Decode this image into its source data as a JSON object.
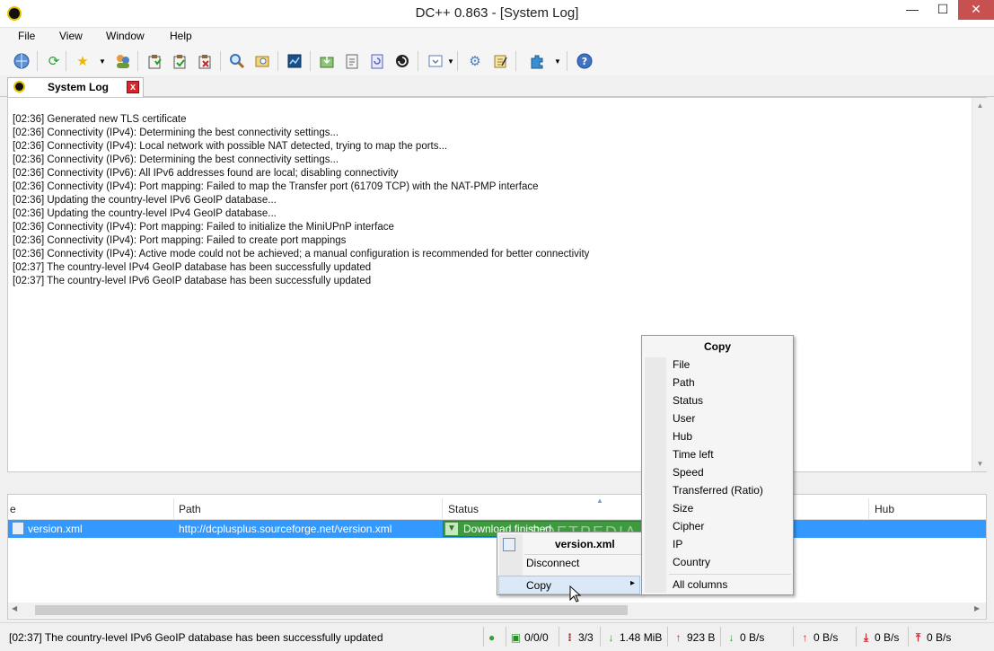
{
  "window": {
    "title": "DC++ 0.863 - [System Log]",
    "minimize": "—",
    "maximize": "☐",
    "close": "✕"
  },
  "menu": [
    "File",
    "View",
    "Window",
    "Help"
  ],
  "tab": {
    "label": "System Log",
    "close": "x"
  },
  "log": [
    "[02:36] Generated new TLS certificate",
    "[02:36] Connectivity (IPv4): Determining the best connectivity settings...",
    "[02:36] Connectivity (IPv4): Local network with possible NAT detected, trying to map the ports...",
    "[02:36] Connectivity (IPv6): Determining the best connectivity settings...",
    "[02:36] Connectivity (IPv6): All IPv6 addresses found are local; disabling connectivity",
    "[02:36] Connectivity (IPv4): Port mapping: Failed to map the Transfer port (61709 TCP) with the NAT-PMP interface",
    "[02:36] Updating the country-level IPv6 GeoIP database...",
    "[02:36] Updating the country-level IPv4 GeoIP database...",
    "[02:36] Connectivity (IPv4): Port mapping: Failed to initialize the MiniUPnP interface",
    "[02:36] Connectivity (IPv4): Port mapping: Failed to create port mappings",
    "[02:36] Connectivity (IPv4): Active mode could not be achieved; a manual configuration is recommended for better connectivity",
    "[02:37] The country-level IPv4 GeoIP database has been successfully updated",
    "[02:37] The country-level IPv6 GeoIP database has been successfully updated"
  ],
  "transfers": {
    "columns": {
      "file": "e",
      "path": "Path",
      "status": "Status",
      "hub": "Hub"
    },
    "row": {
      "file": "version.xml",
      "path": "http://dcplusplus.sourceforge.net/version.xml",
      "status": "Download finished"
    }
  },
  "context_menu": {
    "title": "version.xml",
    "disconnect": "Disconnect",
    "copy": "Copy",
    "submenu_arrow": "▸"
  },
  "copy_menu": {
    "header": "Copy",
    "items": [
      "File",
      "Path",
      "Status",
      "User",
      "Hub",
      "Time left",
      "Speed",
      "Transferred (Ratio)",
      "Size",
      "Cipher",
      "IP",
      "Country"
    ],
    "all": "All columns"
  },
  "statusbar": {
    "message": "[02:37] The country-level IPv6 GeoIP database has been successfully updated",
    "hubs": "0/0/0",
    "slots": "3/3",
    "downloaded": "1.48 MiB",
    "uploaded": "923 B",
    "down_speed": "0 B/s",
    "up_speed": "0 B/s",
    "down_limit": "0 B/s",
    "up_limit": "0 B/s"
  },
  "watermark": "SOFTPEDIA",
  "colors": {
    "selection": "#3399ff",
    "status_ok": "#3d9b3d",
    "close_red": "#c75050"
  }
}
